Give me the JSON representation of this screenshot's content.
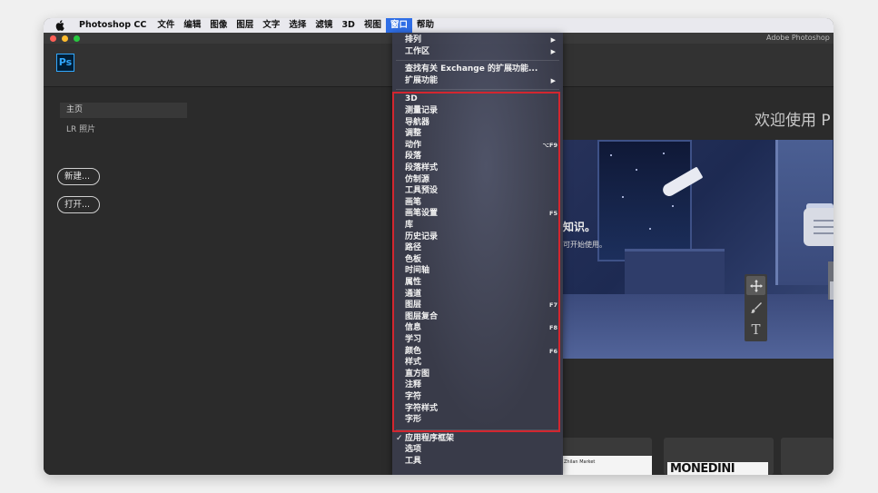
{
  "menubar": {
    "app_name": "Photoshop CC",
    "items": [
      "文件",
      "编辑",
      "图像",
      "图层",
      "文字",
      "选择",
      "滤镜",
      "3D",
      "视图",
      "窗口",
      "帮助"
    ],
    "active_index": 9
  },
  "window": {
    "title": "Adobe Photoshop"
  },
  "app": {
    "logo": "Ps"
  },
  "sidebar": {
    "items": [
      "主页",
      "LR 照片"
    ],
    "new_button": "新建...",
    "open_button": "打开..."
  },
  "welcome": {
    "heading": "欢迎使用 P"
  },
  "hero": {
    "text1": "知识。",
    "text2": "可开始使用。"
  },
  "cards": {
    "card1_text": "Zhilan Market",
    "card2_text": "MONEDINI"
  },
  "window_menu": {
    "top_items": [
      {
        "label": "排列",
        "submenu": true
      },
      {
        "label": "工作区",
        "submenu": true
      }
    ],
    "exchange_items": [
      {
        "label": "查找有关 Exchange 的扩展功能..."
      },
      {
        "label": "扩展功能",
        "submenu": true
      }
    ],
    "panel_items": [
      {
        "label": "3D",
        "shortcut": ""
      },
      {
        "label": "测量记录",
        "shortcut": ""
      },
      {
        "label": "导航器",
        "shortcut": ""
      },
      {
        "label": "调整",
        "shortcut": ""
      },
      {
        "label": "动作",
        "shortcut": "⌥F9"
      },
      {
        "label": "段落",
        "shortcut": ""
      },
      {
        "label": "段落样式",
        "shortcut": ""
      },
      {
        "label": "仿制源",
        "shortcut": ""
      },
      {
        "label": "工具预设",
        "shortcut": ""
      },
      {
        "label": "画笔",
        "shortcut": ""
      },
      {
        "label": "画笔设置",
        "shortcut": "F5"
      },
      {
        "label": "库",
        "shortcut": ""
      },
      {
        "label": "历史记录",
        "shortcut": ""
      },
      {
        "label": "路径",
        "shortcut": ""
      },
      {
        "label": "色板",
        "shortcut": ""
      },
      {
        "label": "时间轴",
        "shortcut": ""
      },
      {
        "label": "属性",
        "shortcut": ""
      },
      {
        "label": "通道",
        "shortcut": ""
      },
      {
        "label": "图层",
        "shortcut": "F7"
      },
      {
        "label": "图层复合",
        "shortcut": ""
      },
      {
        "label": "信息",
        "shortcut": "F8"
      },
      {
        "label": "学习",
        "shortcut": ""
      },
      {
        "label": "颜色",
        "shortcut": "F6"
      },
      {
        "label": "样式",
        "shortcut": ""
      },
      {
        "label": "直方图",
        "shortcut": ""
      },
      {
        "label": "注释",
        "shortcut": ""
      },
      {
        "label": "字符",
        "shortcut": ""
      },
      {
        "label": "字符样式",
        "shortcut": ""
      },
      {
        "label": "字形",
        "shortcut": ""
      }
    ],
    "bottom_items": [
      {
        "label": "应用程序框架",
        "checked": true
      },
      {
        "label": "选项",
        "checked": false
      },
      {
        "label": "工具",
        "checked": false
      }
    ],
    "check_mark": "✓",
    "submenu_arrow": "▶"
  },
  "colors": {
    "menu_active": "#2f6ee6",
    "highlight_border": "#d3262f",
    "ps_blue": "#31a8ff"
  }
}
